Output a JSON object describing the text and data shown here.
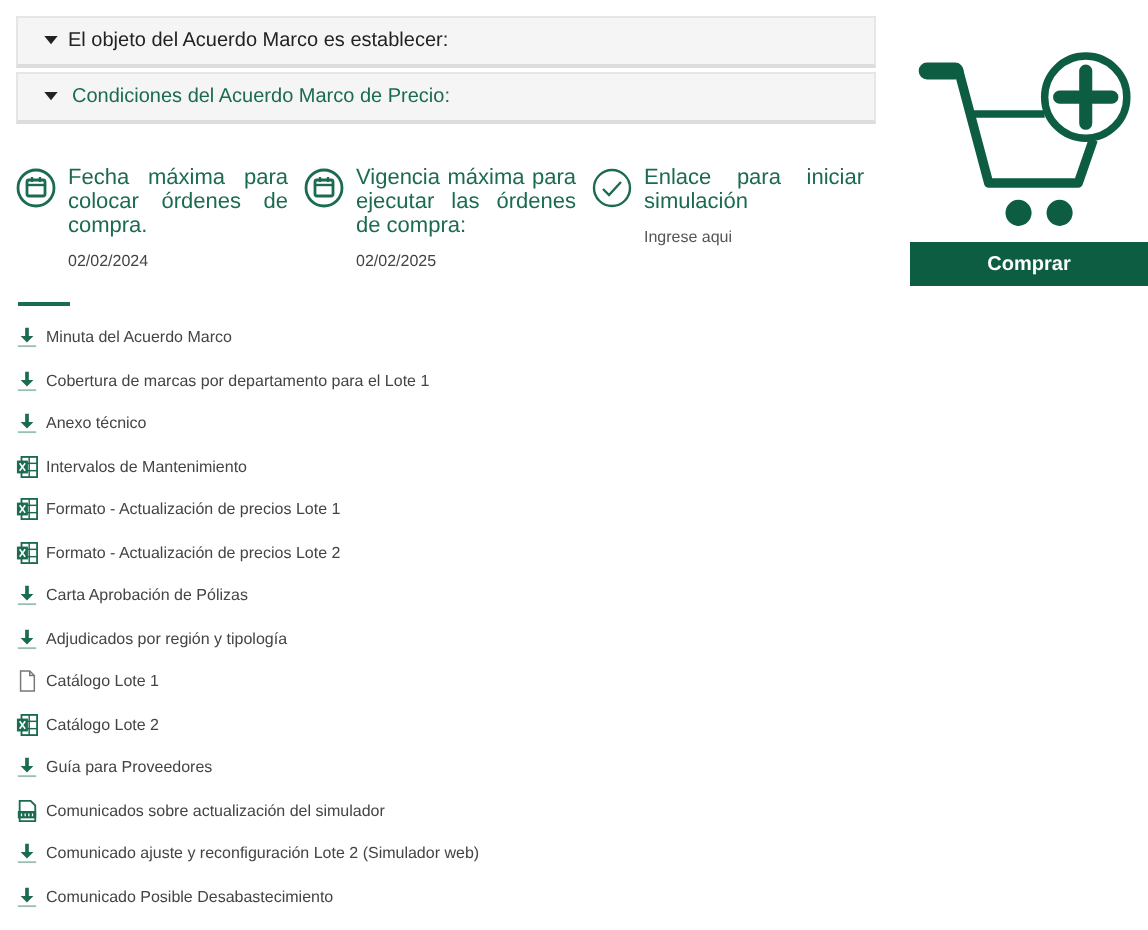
{
  "accordion": [
    {
      "title": "El objeto del Acuerdo Marco es establecer:",
      "expanded": false
    },
    {
      "title": "Condiciones del Acuerdo Marco de Precio:",
      "expanded": true
    }
  ],
  "info": [
    {
      "kind": "calendar",
      "title": "Fecha máxima para colocar órdenes de compra.",
      "value": "02/02/2024"
    },
    {
      "kind": "calendar",
      "title": "Vigencia máxima para ejecutar las órdenes de compra:",
      "value": "02/02/2025"
    },
    {
      "kind": "check",
      "title": "Enlace para iniciar simulación",
      "link": "Ingrese aqui"
    }
  ],
  "documents": [
    {
      "kind": "download",
      "label": "Minuta del Acuerdo Marco"
    },
    {
      "kind": "download",
      "label": "Cobertura de marcas por departamento para el Lote 1"
    },
    {
      "kind": "download",
      "label": "Anexo técnico"
    },
    {
      "kind": "excel",
      "label": "Intervalos de Mantenimiento"
    },
    {
      "kind": "excel",
      "label": "Formato - Actualización de precios Lote 1"
    },
    {
      "kind": "excel",
      "label": "Formato - Actualización de precios Lote 2"
    },
    {
      "kind": "download",
      "label": "Carta Aprobación de Pólizas"
    },
    {
      "kind": "download",
      "label": "Adjudicados por región y tipología"
    },
    {
      "kind": "file",
      "label": "Catálogo Lote 1"
    },
    {
      "kind": "excel",
      "label": "Catálogo Lote 2"
    },
    {
      "kind": "download",
      "label": "Guía para Proveedores"
    },
    {
      "kind": "csv",
      "label": "Comunicados sobre actualización del simulador"
    },
    {
      "kind": "download",
      "label": "Comunicado ajuste y reconfiguración Lote 2 (Simulador web)"
    },
    {
      "kind": "download",
      "label": "Comunicado Posible Desabastecimiento"
    }
  ],
  "buy_button": "Comprar"
}
